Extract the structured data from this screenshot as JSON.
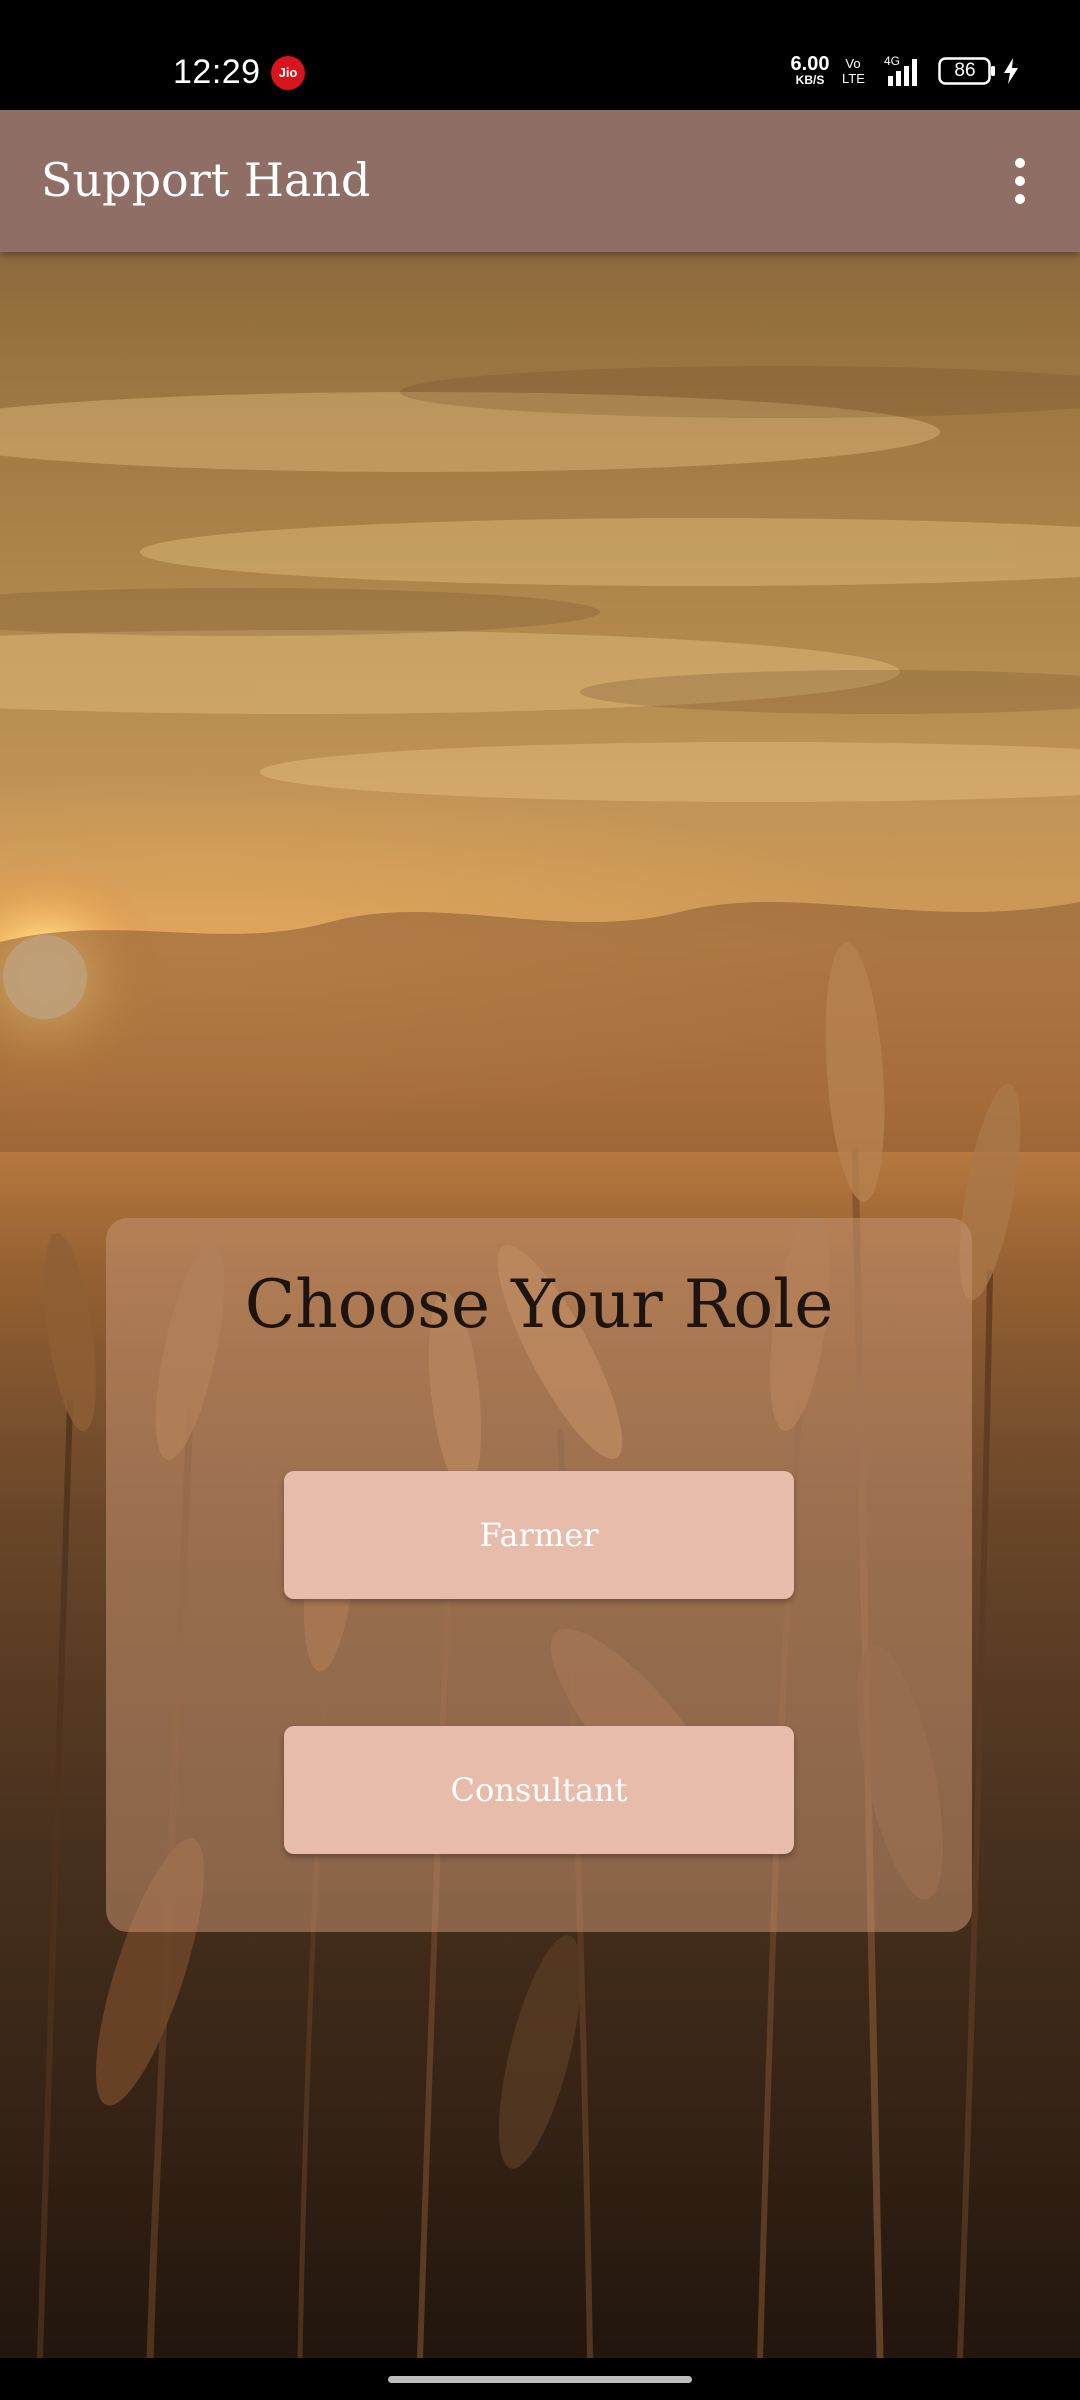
{
  "status_bar": {
    "time": "12:29",
    "carrier_badge": "Jio",
    "net_speed_value": "6.00",
    "net_speed_unit": "KB/S",
    "volte_top": "Vo",
    "volte_bottom": "LTE",
    "network_type": "4G",
    "battery_level": "86",
    "charging": true,
    "icons": [
      "jio-icon",
      "signal-icon",
      "battery-icon",
      "charging-icon"
    ]
  },
  "app_bar": {
    "title": "Support Hand",
    "menu_icon": "overflow-menu-icon",
    "color": "#8f6e65"
  },
  "card": {
    "heading": "Choose Your Role",
    "buttons": [
      {
        "label": "Farmer"
      },
      {
        "label": "Consultant"
      }
    ],
    "button_color": "#e8bcab"
  },
  "background": {
    "image": "wheat field at sunset"
  }
}
